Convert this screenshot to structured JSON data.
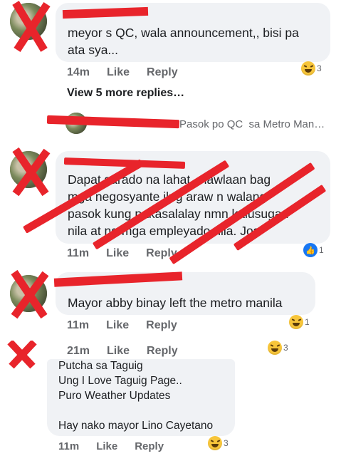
{
  "comments": [
    {
      "text": "meyor s QC, wala announcement,, bisi pa\nata sya...",
      "time": "14m",
      "like": "Like",
      "reply": "Reply",
      "reactions": "3",
      "reaction_type": "haha"
    },
    {
      "text": "Dapat sarado na lahat .. lawlaan bag\nmga negosyante ilng araw n walang\npasok kung nakasalalay nmn kalusugan\nnila at ng mga empleyado nila. Jos",
      "time": "11m",
      "like": "Like",
      "reply": "Reply",
      "reactions": "1",
      "reaction_type": "like"
    },
    {
      "text": "Mayor abby binay left the metro manila",
      "time": "11m",
      "like": "Like",
      "reply": "Reply",
      "reactions": "1",
      "reaction_type": "haha"
    },
    {
      "text": "Putcha sa Taguig\nUng I Love Taguig Page..\nPuro Weather Updates\n\nHay nako mayor Lino Cayetano",
      "time": "11m",
      "like": "Like",
      "reply": "Reply",
      "reactions": "3",
      "reaction_type": "haha"
    }
  ],
  "view_more_replies": "View 5 more replies…",
  "reply_preview": "Pasok po QC  sa Metro Man…",
  "orphan_meta": {
    "time": "21m",
    "like": "Like",
    "reply": "Reply",
    "reactions": "3"
  },
  "colors": {
    "bubble": "#f0f2f5",
    "meta": "#65676b",
    "redact": "#e8242b",
    "like_blue": "#1877f2"
  }
}
